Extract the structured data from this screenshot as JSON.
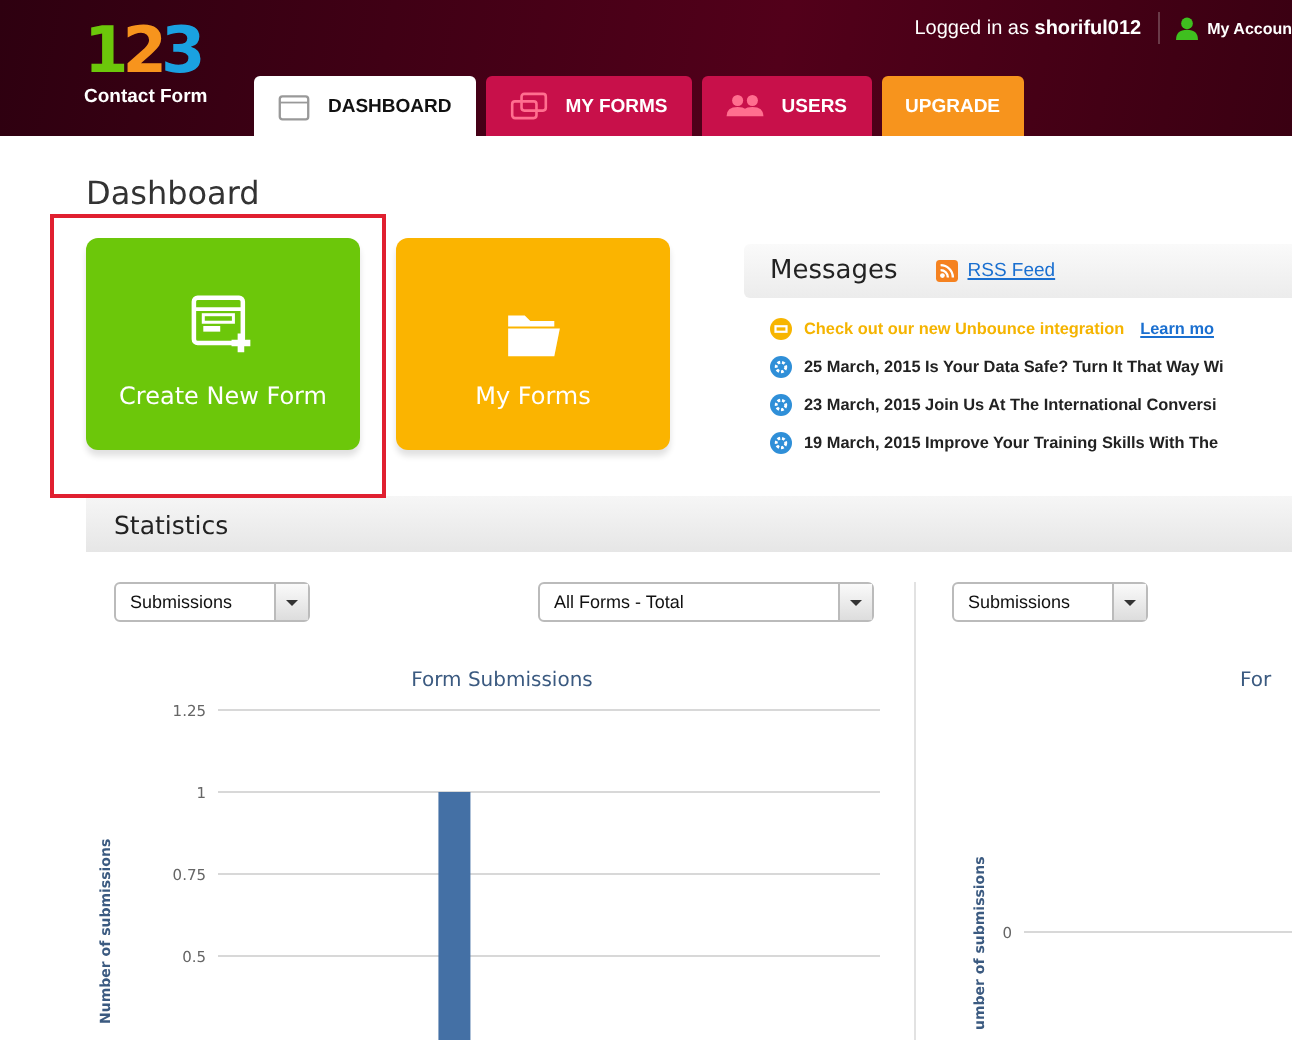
{
  "header": {
    "logo_digits": [
      "1",
      "2",
      "3"
    ],
    "logo_text": "Contact Form",
    "logged_in_label": "Logged in as",
    "username": "shoriful012",
    "account_link": "My Accoun"
  },
  "tabs": [
    {
      "label": "DASHBOARD",
      "kind": "calendar",
      "selected": true,
      "color": "#ffffff"
    },
    {
      "label": "MY FORMS",
      "kind": "windows",
      "selected": false,
      "color": "#c8104a"
    },
    {
      "label": "USERS",
      "kind": "users",
      "selected": false,
      "color": "#c8104a"
    },
    {
      "label": "UPGRADE",
      "kind": "none",
      "selected": false,
      "color": "#f7941d"
    }
  ],
  "page_title": "Dashboard",
  "tiles": [
    {
      "label": "Create New Form",
      "kind": "create",
      "color": "#6cc70a",
      "highlighted": true
    },
    {
      "label": "My Forms",
      "kind": "folder",
      "color": "#fbb400",
      "highlighted": false
    }
  ],
  "messages": {
    "title": "Messages",
    "rss_link": "RSS Feed",
    "items": [
      {
        "kind": "promo",
        "text": "Check out our new Unbounce integration",
        "link": "Learn mo"
      },
      {
        "kind": "news",
        "text": "25 March, 2015 Is Your Data Safe? Turn It That Way Wi"
      },
      {
        "kind": "news",
        "text": "23 March, 2015 Join Us At The International Conversi"
      },
      {
        "kind": "news",
        "text": "19 March, 2015 Improve Your Training Skills With The"
      }
    ]
  },
  "statistics": {
    "title": "Statistics",
    "left": {
      "metric_select": "Submissions",
      "form_select": "All Forms - Total",
      "chart_data": {
        "type": "bar",
        "title": "Form Submissions",
        "ylabel": "Number of submissions",
        "ylim": [
          0,
          1.25
        ],
        "yticks": [
          0.5,
          0.75,
          1,
          1.25
        ],
        "grid": true,
        "series": [
          {
            "color": "#4470a5",
            "values": [
              null,
              null,
              1,
              null,
              null,
              null,
              null
            ]
          }
        ]
      }
    },
    "right": {
      "metric_select": "Submissions",
      "axis_tick": "0",
      "chart_data": {
        "type": "other",
        "title": "For",
        "ylabel": "umber of submissions"
      }
    }
  }
}
